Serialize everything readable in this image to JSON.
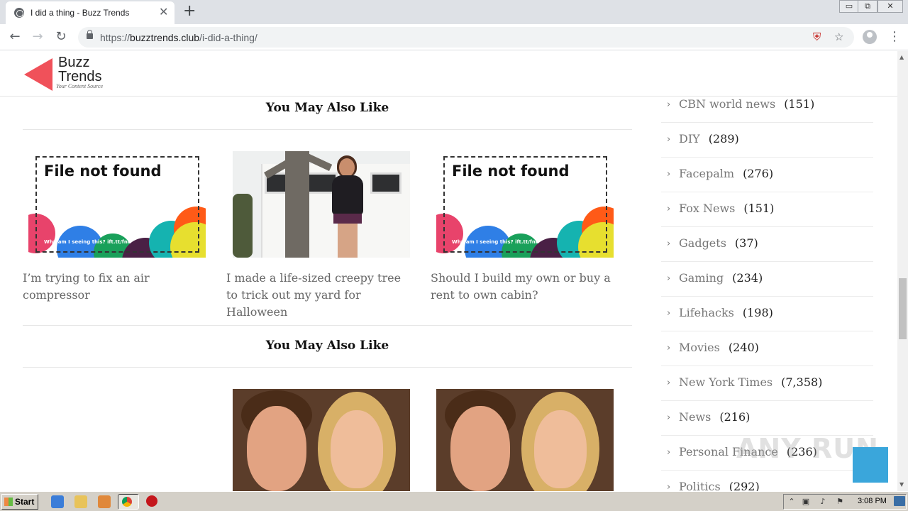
{
  "browser": {
    "tab_title": "I did a thing - Buzz Trends",
    "tab_close": "✕",
    "new_tab": "+",
    "url_scheme": "https://",
    "url_host": "buzztrends.club",
    "url_path": "/i-did-a-thing/",
    "window_controls": [
      "▭",
      "⧉",
      "✕"
    ]
  },
  "site": {
    "logo_line1": "Buzz",
    "logo_line2": "Trends",
    "logo_tagline": "Your Content Source"
  },
  "sections": [
    {
      "title": "You May Also Like",
      "cards": [
        {
          "title": "I’m trying to fix an air compressor",
          "image": "file-not-found"
        },
        {
          "title": "I made a life-sized creepy tree to trick out my yard for Halloween",
          "image": "tree-photo"
        },
        {
          "title": "Should I build my own or buy a rent to own cabin?",
          "image": "file-not-found"
        }
      ]
    },
    {
      "title": "You May Also Like",
      "cards": [
        {
          "title": "",
          "image": "none"
        },
        {
          "title": "",
          "image": "couple-photo"
        },
        {
          "title": "",
          "image": "couple-photo"
        }
      ]
    }
  ],
  "placeholder": {
    "heading": "File not found",
    "subtext": "Why am I seeing this? ift.tt/fnf"
  },
  "categories": [
    {
      "name": "CBN world news",
      "count": "(151)"
    },
    {
      "name": "DIY",
      "count": "(289)"
    },
    {
      "name": "Facepalm",
      "count": "(276)"
    },
    {
      "name": "Fox News",
      "count": "(151)"
    },
    {
      "name": "Gadgets",
      "count": "(37)"
    },
    {
      "name": "Gaming",
      "count": "(234)"
    },
    {
      "name": "Lifehacks",
      "count": "(198)"
    },
    {
      "name": "Movies",
      "count": "(240)"
    },
    {
      "name": "New York Times",
      "count": "(7,358)"
    },
    {
      "name": "News",
      "count": "(216)"
    },
    {
      "name": "Personal Finance",
      "count": "(236)"
    },
    {
      "name": "Politics",
      "count": "(292)"
    }
  ],
  "watermark": "ANY RUN",
  "taskbar": {
    "start_label": "Start",
    "clock": "3:08 PM"
  },
  "colors": {
    "accent": "#3aa6db",
    "logo_red": "#f0515a"
  }
}
